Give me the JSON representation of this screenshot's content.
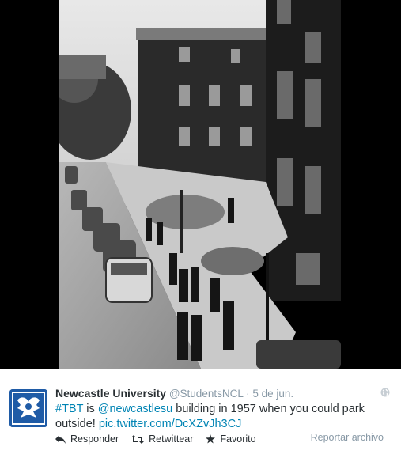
{
  "photo": {
    "alt_semantic": "black-and-white-campus-photo"
  },
  "tweet": {
    "display_name": "Newcastle University",
    "handle": "@StudentsNCL",
    "separator": "·",
    "timestamp": "5 de jun.",
    "text": {
      "hashtag": "#TBT",
      "part1": " is ",
      "mention": "@newcastlesu",
      "part2": " building in 1957 when you could park outside! ",
      "pic_link": "pic.twitter.com/DcXZvJh3CJ"
    },
    "actions": {
      "reply": "Responder",
      "retweet": "Retwittear",
      "favorite": "Favorito"
    },
    "report": "Reportar archivo"
  },
  "colors": {
    "link": "#0084b4",
    "text": "#292f33",
    "muted": "#8899a6",
    "avatar_bg": "#1f5ba6"
  },
  "icons": [
    "reply-icon",
    "retweet-icon",
    "star-icon",
    "globe-icon",
    "university-crest-icon"
  ]
}
